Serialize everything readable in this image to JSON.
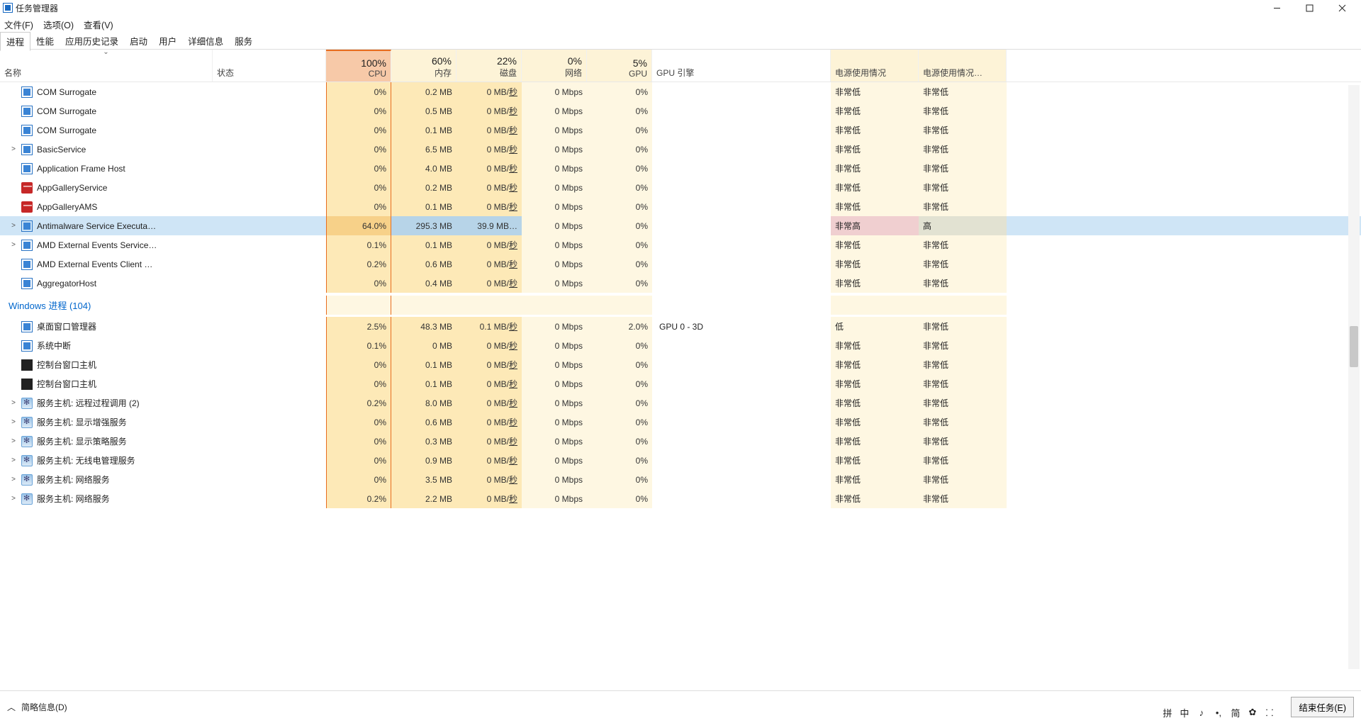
{
  "window": {
    "title": "任务管理器",
    "minimize": "—",
    "maximize": "□",
    "close": "✕"
  },
  "menu": {
    "file": "文件(F)",
    "options": "选项(O)",
    "view": "查看(V)"
  },
  "tabs": {
    "processes": "进程",
    "performance": "性能",
    "history": "应用历史记录",
    "startup": "启动",
    "users": "用户",
    "details": "详细信息",
    "services": "服务"
  },
  "columns": {
    "name": "名称",
    "status": "状态",
    "cpu_pct": "100%",
    "cpu_lbl": "CPU",
    "mem_pct": "60%",
    "mem_lbl": "内存",
    "disk_pct": "22%",
    "disk_lbl": "磁盘",
    "net_pct": "0%",
    "net_lbl": "网络",
    "gpu_pct": "5%",
    "gpu_lbl": "GPU",
    "gpu_engine": "GPU 引擎",
    "power": "电源使用情况",
    "power_trend": "电源使用情况…"
  },
  "group_label": "Windows 进程 (104)",
  "rows": [
    {
      "exp": "",
      "icon": "blue",
      "name": "COM Surrogate",
      "cpu": "0%",
      "mem": "0.2 MB",
      "disk": "0 MB/秒",
      "net": "0 Mbps",
      "gpu": "0%",
      "geng": "",
      "pwr": "非常低",
      "ptr": "非常低"
    },
    {
      "exp": "",
      "icon": "blue",
      "name": "COM Surrogate",
      "cpu": "0%",
      "mem": "0.5 MB",
      "disk": "0 MB/秒",
      "net": "0 Mbps",
      "gpu": "0%",
      "geng": "",
      "pwr": "非常低",
      "ptr": "非常低"
    },
    {
      "exp": "",
      "icon": "blue",
      "name": "COM Surrogate",
      "cpu": "0%",
      "mem": "0.1 MB",
      "disk": "0 MB/秒",
      "net": "0 Mbps",
      "gpu": "0%",
      "geng": "",
      "pwr": "非常低",
      "ptr": "非常低"
    },
    {
      "exp": ">",
      "icon": "blue",
      "name": "BasicService",
      "cpu": "0%",
      "mem": "6.5 MB",
      "disk": "0 MB/秒",
      "net": "0 Mbps",
      "gpu": "0%",
      "geng": "",
      "pwr": "非常低",
      "ptr": "非常低"
    },
    {
      "exp": "",
      "icon": "blue",
      "name": "Application Frame Host",
      "cpu": "0%",
      "mem": "4.0 MB",
      "disk": "0 MB/秒",
      "net": "0 Mbps",
      "gpu": "0%",
      "geng": "",
      "pwr": "非常低",
      "ptr": "非常低"
    },
    {
      "exp": "",
      "icon": "red",
      "name": "AppGalleryService",
      "cpu": "0%",
      "mem": "0.2 MB",
      "disk": "0 MB/秒",
      "net": "0 Mbps",
      "gpu": "0%",
      "geng": "",
      "pwr": "非常低",
      "ptr": "非常低"
    },
    {
      "exp": "",
      "icon": "red",
      "name": "AppGalleryAMS",
      "cpu": "0%",
      "mem": "0.1 MB",
      "disk": "0 MB/秒",
      "net": "0 Mbps",
      "gpu": "0%",
      "geng": "",
      "pwr": "非常低",
      "ptr": "非常低"
    },
    {
      "exp": ">",
      "icon": "blue",
      "name": "Antimalware Service Executa…",
      "cpu": "64.0%",
      "mem": "295.3 MB",
      "disk": "39.9 MB…",
      "net": "0 Mbps",
      "gpu": "0%",
      "geng": "",
      "pwr": "非常高",
      "ptr": "高",
      "selected": true,
      "heavy": true
    },
    {
      "exp": ">",
      "icon": "blue",
      "name": "AMD External Events Service…",
      "cpu": "0.1%",
      "mem": "0.1 MB",
      "disk": "0 MB/秒",
      "net": "0 Mbps",
      "gpu": "0%",
      "geng": "",
      "pwr": "非常低",
      "ptr": "非常低"
    },
    {
      "exp": "",
      "icon": "blue",
      "name": "AMD External Events Client …",
      "cpu": "0.2%",
      "mem": "0.6 MB",
      "disk": "0 MB/秒",
      "net": "0 Mbps",
      "gpu": "0%",
      "geng": "",
      "pwr": "非常低",
      "ptr": "非常低"
    },
    {
      "exp": "",
      "icon": "blue",
      "name": "AggregatorHost",
      "cpu": "0%",
      "mem": "0.4 MB",
      "disk": "0 MB/秒",
      "net": "0 Mbps",
      "gpu": "0%",
      "geng": "",
      "pwr": "非常低",
      "ptr": "非常低"
    },
    {
      "group": true,
      "name": "Windows 进程 (104)"
    },
    {
      "exp": "",
      "icon": "blue",
      "name": "桌面窗口管理器",
      "cpu": "2.5%",
      "mem": "48.3 MB",
      "disk": "0.1 MB/秒",
      "net": "0 Mbps",
      "gpu": "2.0%",
      "geng": "GPU 0 - 3D",
      "pwr": "低",
      "ptr": "非常低"
    },
    {
      "exp": "",
      "icon": "blue",
      "name": "系统中断",
      "cpu": "0.1%",
      "mem": "0 MB",
      "disk": "0 MB/秒",
      "net": "0 Mbps",
      "gpu": "0%",
      "geng": "",
      "pwr": "非常低",
      "ptr": "非常低"
    },
    {
      "exp": "",
      "icon": "term",
      "name": "控制台窗口主机",
      "cpu": "0%",
      "mem": "0.1 MB",
      "disk": "0 MB/秒",
      "net": "0 Mbps",
      "gpu": "0%",
      "geng": "",
      "pwr": "非常低",
      "ptr": "非常低"
    },
    {
      "exp": "",
      "icon": "term",
      "name": "控制台窗口主机",
      "cpu": "0%",
      "mem": "0.1 MB",
      "disk": "0 MB/秒",
      "net": "0 Mbps",
      "gpu": "0%",
      "geng": "",
      "pwr": "非常低",
      "ptr": "非常低"
    },
    {
      "exp": ">",
      "icon": "gear",
      "name": "服务主机: 远程过程调用 (2)",
      "cpu": "0.2%",
      "mem": "8.0 MB",
      "disk": "0 MB/秒",
      "net": "0 Mbps",
      "gpu": "0%",
      "geng": "",
      "pwr": "非常低",
      "ptr": "非常低"
    },
    {
      "exp": ">",
      "icon": "gear",
      "name": "服务主机: 显示增强服务",
      "cpu": "0%",
      "mem": "0.6 MB",
      "disk": "0 MB/秒",
      "net": "0 Mbps",
      "gpu": "0%",
      "geng": "",
      "pwr": "非常低",
      "ptr": "非常低"
    },
    {
      "exp": ">",
      "icon": "gear",
      "name": "服务主机: 显示策略服务",
      "cpu": "0%",
      "mem": "0.3 MB",
      "disk": "0 MB/秒",
      "net": "0 Mbps",
      "gpu": "0%",
      "geng": "",
      "pwr": "非常低",
      "ptr": "非常低"
    },
    {
      "exp": ">",
      "icon": "gear",
      "name": "服务主机: 无线电管理服务",
      "cpu": "0%",
      "mem": "0.9 MB",
      "disk": "0 MB/秒",
      "net": "0 Mbps",
      "gpu": "0%",
      "geng": "",
      "pwr": "非常低",
      "ptr": "非常低"
    },
    {
      "exp": ">",
      "icon": "gear",
      "name": "服务主机: 网络服务",
      "cpu": "0%",
      "mem": "3.5 MB",
      "disk": "0 MB/秒",
      "net": "0 Mbps",
      "gpu": "0%",
      "geng": "",
      "pwr": "非常低",
      "ptr": "非常低"
    },
    {
      "exp": ">",
      "icon": "gear",
      "name": "服务主机: 网络服务",
      "cpu": "0.2%",
      "mem": "2.2 MB",
      "disk": "0 MB/秒",
      "net": "0 Mbps",
      "gpu": "0%",
      "geng": "",
      "pwr": "非常低",
      "ptr": "非常低"
    }
  ],
  "footer": {
    "fewer": "简略信息(D)",
    "end_task": "结束任务(E)"
  },
  "ime": {
    "a": "拼",
    "b": "中",
    "c": "♪",
    "d": "•,",
    "e": "简",
    "f": "✿",
    "g": "⸬"
  }
}
